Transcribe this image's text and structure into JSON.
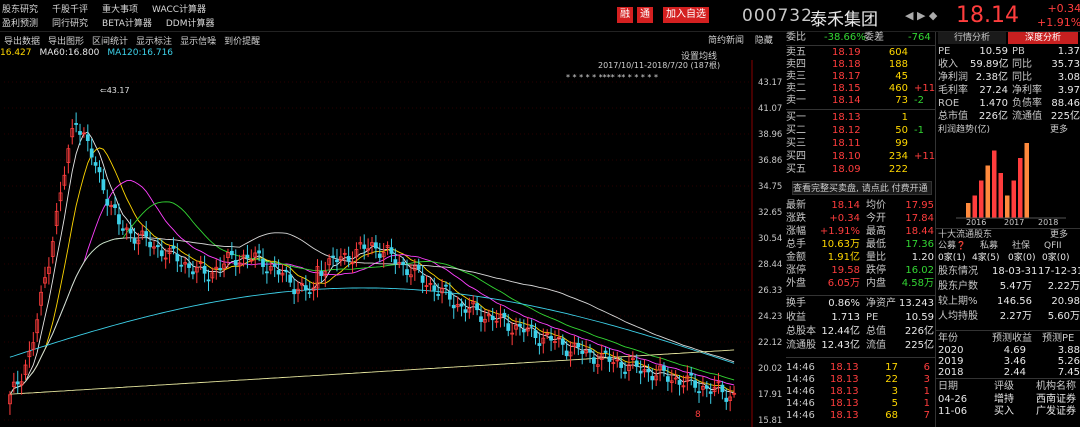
{
  "colors": {
    "up": "#ff3d3d",
    "down": "#33d633",
    "neutral": "#e8e8e8",
    "accent_blue": "#1e6fd9"
  },
  "menu": {
    "row1": [
      "股东研究",
      "千股千评",
      "重大事项",
      "WACC计算器"
    ],
    "row2": [
      "盈利预测",
      "同行研究",
      "BETA计算器",
      "DDM计算器"
    ]
  },
  "header": {
    "btn_finance": "融",
    "btn_tong": "通",
    "btn_add": "加入自选",
    "code": "000732",
    "name": "泰禾集团",
    "nav_arrows": "◀ ▶ ◆",
    "price": "18.14",
    "change": "+0.34",
    "pct": "+1.91%"
  },
  "toolbar": {
    "items": [
      "导出数据",
      "导出图形",
      "区间统计",
      "显示标注",
      "显示信噪",
      "到价提醒"
    ],
    "setting": "设置均线",
    "right": [
      "简约新闻",
      "隐藏"
    ],
    "range": "2017/10/11-2018/7/20 (187根)"
  },
  "ma": {
    "ma_a": "16.427",
    "ma60_label": "MA60:16.800",
    "ma120_label": "MA120:16.716"
  },
  "chart_data": {
    "type": "candlestick",
    "y_ticks": [
      "43.17",
      "41.07",
      "38.96",
      "36.86",
      "34.75",
      "32.65",
      "30.54",
      "28.44",
      "26.33",
      "24.23",
      "22.12",
      "20.02",
      "17.91",
      "15.81"
    ],
    "ylim": [
      15.81,
      43.17
    ],
    "annotation_high": "43.17",
    "markers": "* * * * * **** ** * * * * *",
    "bottom_marker": "8"
  },
  "order_book": {
    "webi": "委比",
    "webi_val": "-38.66%",
    "wc": "委差",
    "wc_val": "-764",
    "asks": [
      {
        "name": "卖五",
        "price": "18.19",
        "vol": "604",
        "chg": ""
      },
      {
        "name": "卖四",
        "price": "18.18",
        "vol": "188",
        "chg": ""
      },
      {
        "name": "卖三",
        "price": "18.17",
        "vol": "45",
        "chg": ""
      },
      {
        "name": "卖二",
        "price": "18.15",
        "vol": "460",
        "chg": "+11"
      },
      {
        "name": "卖一",
        "price": "18.14",
        "vol": "73",
        "chg": "-2"
      }
    ],
    "bids": [
      {
        "name": "买一",
        "price": "18.13",
        "vol": "1",
        "chg": ""
      },
      {
        "name": "买二",
        "price": "18.12",
        "vol": "50",
        "chg": "-1"
      },
      {
        "name": "买三",
        "price": "18.11",
        "vol": "99",
        "chg": ""
      },
      {
        "name": "买四",
        "price": "18.10",
        "vol": "234",
        "chg": "+11"
      },
      {
        "name": "买五",
        "price": "18.09",
        "vol": "222",
        "chg": ""
      }
    ],
    "promo": "查看完整买卖盘, 请点此 付费开通"
  },
  "quote": {
    "rows": [
      [
        "最新",
        "18.14",
        "均价",
        "17.95"
      ],
      [
        "涨跌",
        "+0.34",
        "今开",
        "17.84"
      ],
      [
        "涨幅",
        "+1.91%",
        "最高",
        "18.44"
      ],
      [
        "总手",
        "10.63万",
        "最低",
        "17.36"
      ],
      [
        "金额",
        "1.91亿",
        "量比",
        "1.20"
      ],
      [
        "涨停",
        "19.58",
        "跌停",
        "16.02"
      ],
      [
        "外盘",
        "6.05万",
        "内盘",
        "4.58万"
      ]
    ],
    "rows2": [
      [
        "换手",
        "0.86%",
        "净资产",
        "13.243"
      ],
      [
        "收益",
        "1.713",
        "PE",
        "10.59"
      ],
      [
        "总股本",
        "12.44亿",
        "总值",
        "226亿"
      ],
      [
        "流通股",
        "12.43亿",
        "流值",
        "225亿"
      ]
    ]
  },
  "ticks": [
    [
      "14:46",
      "18.13",
      "17",
      "6"
    ],
    [
      "14:46",
      "18.13",
      "22",
      "3"
    ],
    [
      "14:46",
      "18.13",
      "3",
      "1"
    ],
    [
      "14:46",
      "18.13",
      "5",
      "1"
    ],
    [
      "14:46",
      "18.13",
      "68",
      "7"
    ]
  ],
  "fundamentals": {
    "tab1": "行情分析",
    "tab2": "深度分析",
    "rows": [
      [
        "PE",
        "10.59",
        "PB",
        "1.37"
      ],
      [
        "收入",
        "59.89亿",
        "同比",
        "35.73"
      ],
      [
        "净利润",
        "2.38亿",
        "同比",
        "3.08"
      ],
      [
        "毛利率",
        "27.24",
        "净利率",
        "3.97"
      ],
      [
        "ROE",
        "1.470",
        "负债率",
        "88.46"
      ],
      [
        "总市值",
        "226亿",
        "流通值",
        "225亿"
      ]
    ],
    "trend_title": "利润趋势(亿)",
    "more": "更多",
    "years": [
      "2016",
      "2017",
      "2018"
    ],
    "bars": [
      2,
      3,
      5,
      7,
      9,
      6,
      3,
      5,
      8,
      10
    ],
    "holders_title": "十大流通股东",
    "holders_more": "更多",
    "holders_cols": [
      "公募",
      "私募",
      "社保",
      "QFII"
    ],
    "holders_vals": [
      "0家(1)",
      "4家(5)",
      "0家(0)",
      "0家(0)"
    ],
    "holder_rows": [
      [
        "股东情况",
        "18-03-31",
        "17-12-31"
      ],
      [
        "股东户数",
        "5.47万",
        "2.22万"
      ],
      [
        "较上期%",
        "146.56",
        "20.98"
      ],
      [
        "人均持股",
        "2.27万",
        "5.60万"
      ]
    ],
    "forecast_cols": [
      "年份",
      "预测收益",
      "预测PE"
    ],
    "forecast": [
      [
        "2020",
        "4.69",
        "3.88"
      ],
      [
        "2019",
        "3.46",
        "5.26"
      ],
      [
        "2018",
        "2.44",
        "7.45"
      ]
    ],
    "rating_cols": [
      "日期",
      "评级",
      "机构名称"
    ],
    "ratings": [
      [
        "04-26",
        "增持",
        "西南证券"
      ],
      [
        "11-06",
        "买入",
        "广发证券"
      ]
    ]
  }
}
